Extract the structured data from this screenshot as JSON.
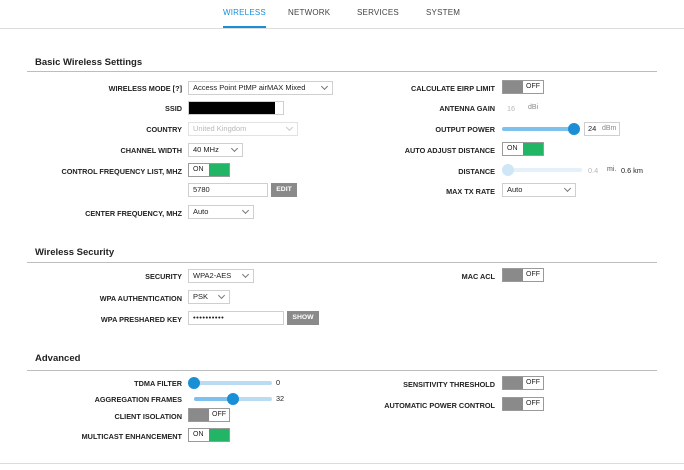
{
  "nav": {
    "tabs": [
      {
        "label": "WIRELESS"
      },
      {
        "label": "NETWORK"
      },
      {
        "label": "SERVICES"
      },
      {
        "label": "SYSTEM"
      }
    ]
  },
  "basic": {
    "title": "Basic Wireless Settings",
    "wireless_mode": {
      "label": "WIRELESS MODE [?]",
      "value": "Access Point PtMP airMAX Mixed"
    },
    "ssid": {
      "label": "SSID",
      "value": ""
    },
    "country": {
      "label": "COUNTRY",
      "value": "United Kingdom"
    },
    "channel_width": {
      "label": "CHANNEL WIDTH",
      "value": "40 MHz"
    },
    "control_freq": {
      "label": "CONTROL FREQUENCY LIST, MHz",
      "toggle": "ON",
      "value": "5780",
      "edit": "EDIT"
    },
    "center_freq": {
      "label": "CENTER FREQUENCY, MHz",
      "value": "Auto"
    },
    "calc_eirp": {
      "label": "CALCULATE EIRP LIMIT",
      "toggle": "OFF"
    },
    "antenna_gain": {
      "label": "ANTENNA GAIN",
      "value": "16",
      "unit": "dBi"
    },
    "output_power": {
      "label": "OUTPUT POWER",
      "value": "24",
      "unit": "dBm",
      "level_fraction": 0.97
    },
    "auto_adjust": {
      "label": "AUTO ADJUST DISTANCE",
      "toggle": "ON"
    },
    "distance": {
      "label": "DISTANCE",
      "value": "0.4",
      "unit": "mi.",
      "km": "0.6 km",
      "level_fraction": 0.0
    },
    "max_tx": {
      "label": "MAX TX RATE",
      "value": "Auto"
    }
  },
  "security": {
    "title": "Wireless Security",
    "security": {
      "label": "SECURITY",
      "value": "WPA2-AES"
    },
    "wpa_auth": {
      "label": "WPA AUTHENTICATION",
      "value": "PSK"
    },
    "psk": {
      "label": "WPA PRESHARED KEY",
      "value": "••••••••••",
      "show": "SHOW"
    },
    "mac_acl": {
      "label": "MAC ACL",
      "toggle": "OFF"
    }
  },
  "advanced": {
    "title": "Advanced",
    "tdma": {
      "label": "TDMA FILTER",
      "value": "0",
      "level_fraction": 0.0
    },
    "aggregation": {
      "label": "AGGREGATION FRAMES",
      "value": "32",
      "level_fraction": 0.5
    },
    "client_isolation": {
      "label": "CLIENT ISOLATION",
      "toggle": "OFF"
    },
    "multicast": {
      "label": "MULTICAST ENHANCEMENT",
      "toggle": "ON"
    },
    "sensitivity": {
      "label": "SENSITIVITY THRESHOLD",
      "toggle": "OFF"
    },
    "auto_power": {
      "label": "AUTOMATIC POWER CONTROL",
      "toggle": "OFF"
    }
  },
  "colors": {
    "accent": "#1a8fd6",
    "on": "#22b566",
    "off": "#8a8a8a"
  }
}
